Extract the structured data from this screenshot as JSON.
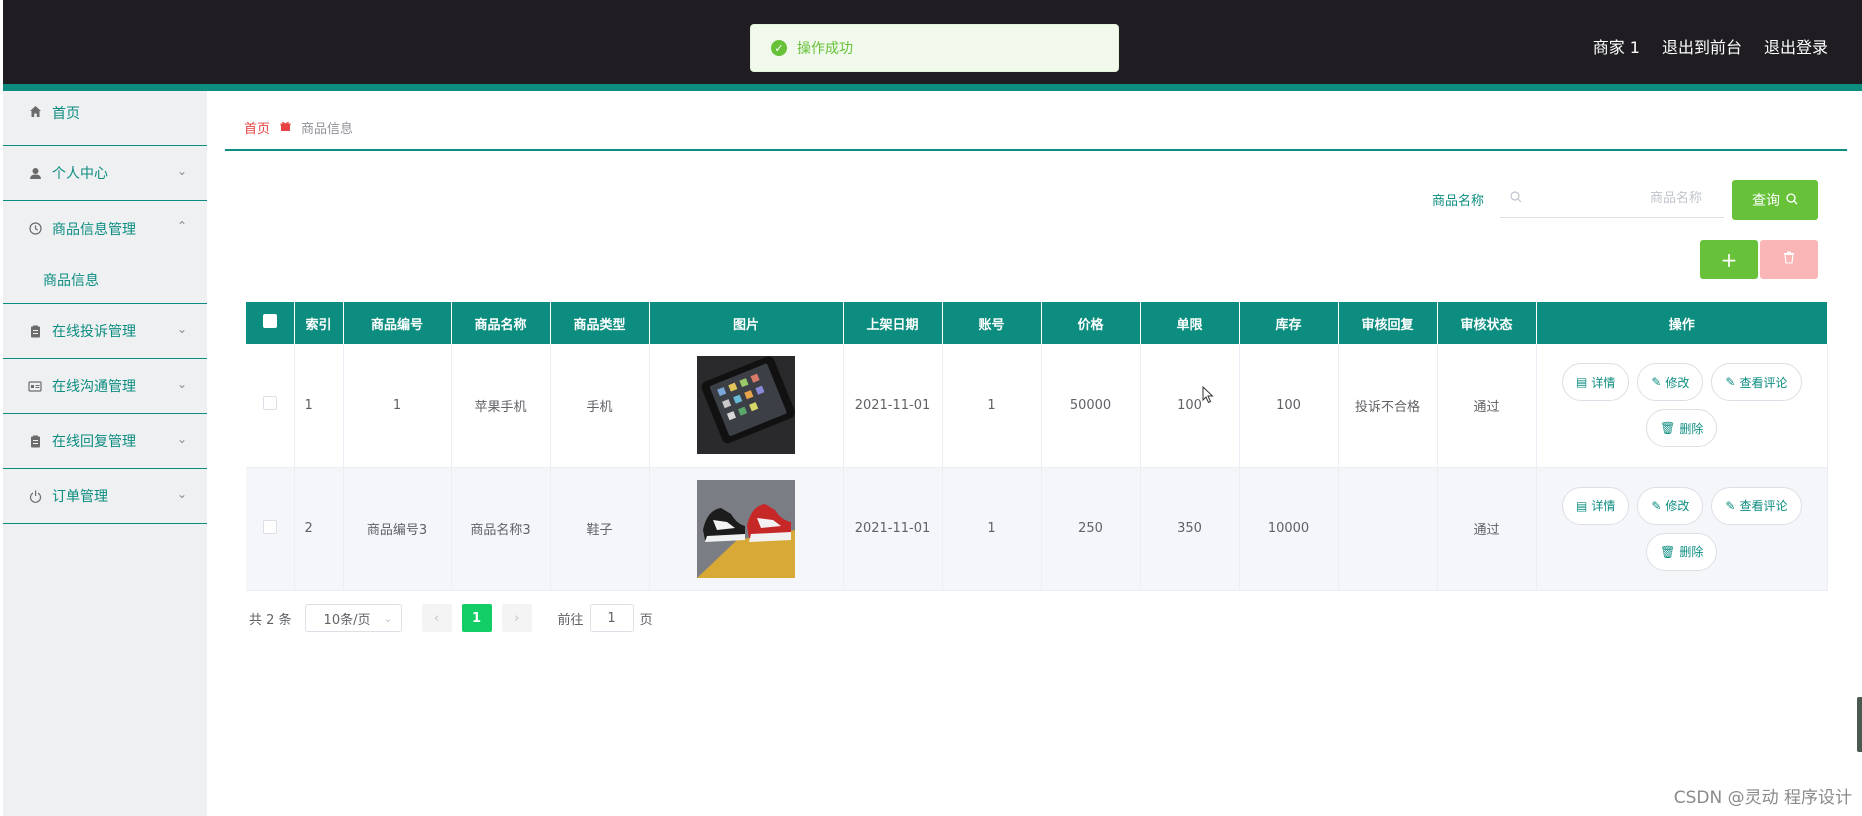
{
  "header": {
    "user_label": "商家 1",
    "back_front_label": "退出到前台",
    "logout_label": "退出登录"
  },
  "toast": {
    "text": "操作成功"
  },
  "sidebar": {
    "items": [
      {
        "label": "首页",
        "icon": "home-icon"
      },
      {
        "label": "个人中心",
        "icon": "user-icon"
      },
      {
        "label": "商品信息管理",
        "icon": "clock-icon",
        "expanded": true,
        "children": [
          "商品信息"
        ]
      },
      {
        "label": "在线投诉管理",
        "icon": "clipboard-icon"
      },
      {
        "label": "在线沟通管理",
        "icon": "card-icon"
      },
      {
        "label": "在线回复管理",
        "icon": "clipboard-icon"
      },
      {
        "label": "订单管理",
        "icon": "power-icon"
      }
    ]
  },
  "breadcrumb": {
    "home": "首页",
    "current": "商品信息"
  },
  "search": {
    "label": "商品名称",
    "placeholder": "商品名称",
    "query_label": "查询"
  },
  "table": {
    "headers": [
      "索引",
      "商品编号",
      "商品名称",
      "商品类型",
      "图片",
      "上架日期",
      "账号",
      "价格",
      "单限",
      "库存",
      "审核回复",
      "审核状态",
      "操作"
    ],
    "rows": [
      {
        "index": "1",
        "code": "1",
        "name": "苹果手机",
        "type": "手机",
        "image": "phone",
        "date": "2021-11-01",
        "account": "1",
        "price": "50000",
        "limit": "100",
        "stock": "100",
        "reply": "投诉不合格",
        "status": "通过"
      },
      {
        "index": "2",
        "code": "商品编号3",
        "name": "商品名称3",
        "type": "鞋子",
        "image": "sneakers",
        "date": "2021-11-01",
        "account": "1",
        "price": "250",
        "limit": "350",
        "stock": "10000",
        "reply": "",
        "status": "通过"
      }
    ],
    "ops": {
      "detail": "详情",
      "edit": "修改",
      "comments": "查看评论",
      "delete": "删除"
    }
  },
  "pager": {
    "total": "共 2 条",
    "page_size": "10条/页",
    "current": "1",
    "goto_label": "前往",
    "goto_value": "1",
    "page_unit": "页"
  },
  "watermark": "CSDN @灵动 程序设计",
  "colors": {
    "accent": "#0d8d80",
    "success": "#67c23a",
    "danger_light": "#fab6b6",
    "topbar": "#1f1d21"
  }
}
